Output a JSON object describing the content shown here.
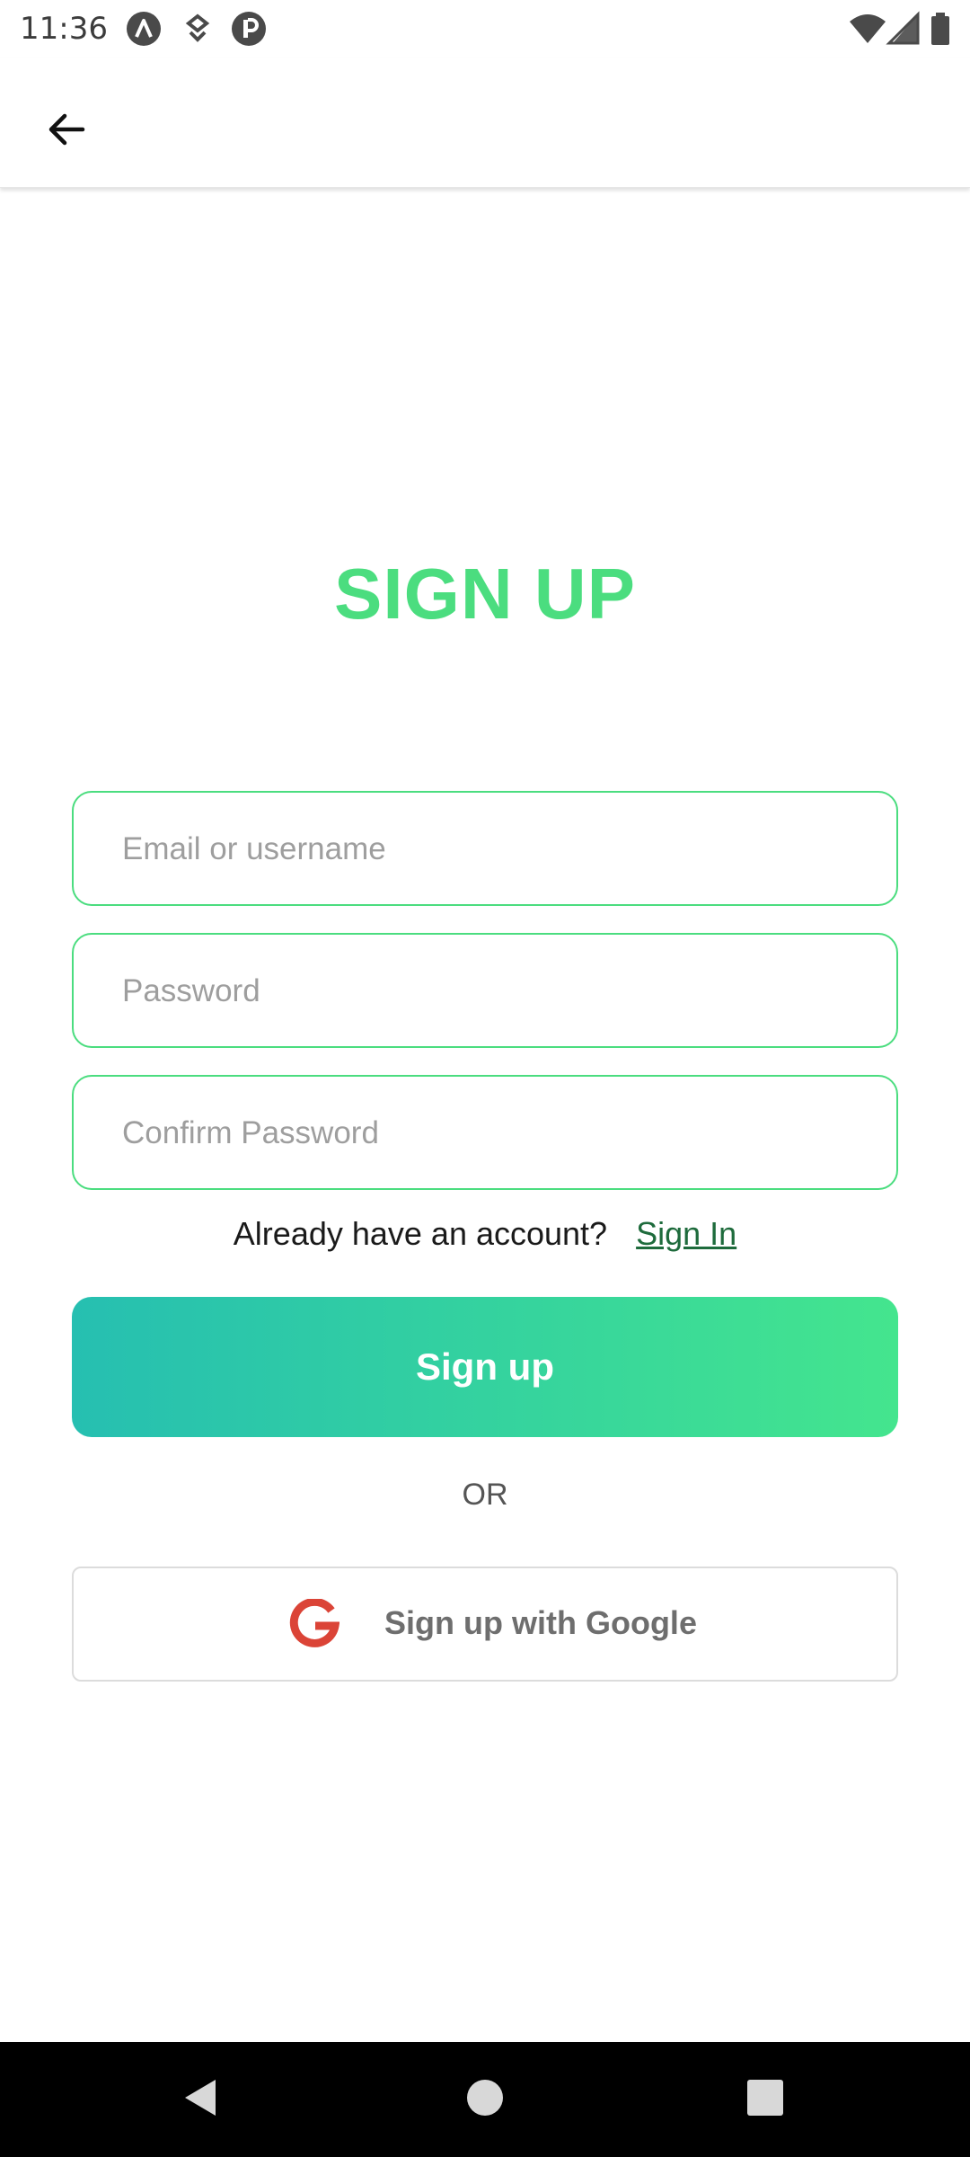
{
  "status_bar": {
    "time": "11:36",
    "left_icons": [
      "app-a-icon",
      "download-shield-icon",
      "p-badge-icon"
    ],
    "right_icons": [
      "wifi-icon",
      "cell-signal-icon",
      "battery-icon"
    ]
  },
  "app_bar": {
    "back_icon": "arrow-left-icon"
  },
  "title": "SIGN UP",
  "form": {
    "email_placeholder": "Email or username",
    "password_placeholder": "Password",
    "confirm_placeholder": "Confirm Password",
    "email_value": "",
    "password_value": "",
    "confirm_value": ""
  },
  "account_prompt": {
    "text": "Already have an account?",
    "link": "Sign In"
  },
  "signup_button": "Sign up",
  "or_label": "OR",
  "google_button": {
    "label": "Sign up with Google",
    "icon": "google-icon"
  },
  "colors": {
    "accent": "#4bdd7f",
    "gradient_start": "#26bfb1",
    "gradient_end": "#44e58e",
    "link": "#1e6b3c",
    "google_red": "#db4437"
  },
  "nav_bar": {
    "buttons": [
      "back-triangle-icon",
      "home-circle-icon",
      "recents-square-icon"
    ]
  }
}
